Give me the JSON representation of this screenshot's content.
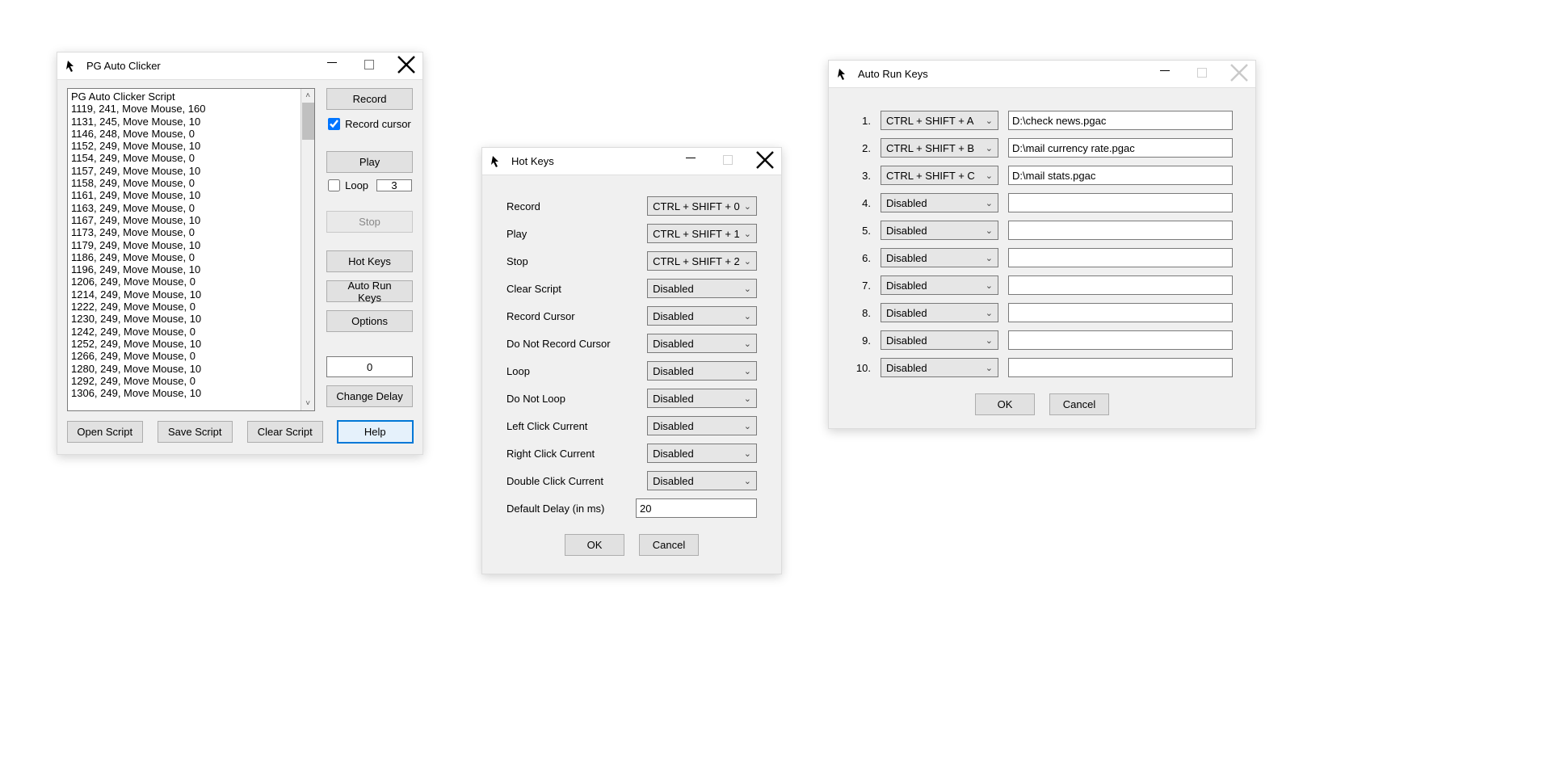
{
  "main": {
    "title": "PG Auto Clicker",
    "script_lines": [
      "PG Auto Clicker Script",
      "1119, 241, Move Mouse, 160",
      "1131, 245, Move Mouse, 10",
      "1146, 248, Move Mouse, 0",
      "1152, 249, Move Mouse, 10",
      "1154, 249, Move Mouse, 0",
      "1157, 249, Move Mouse, 10",
      "1158, 249, Move Mouse, 0",
      "1161, 249, Move Mouse, 10",
      "1163, 249, Move Mouse, 0",
      "1167, 249, Move Mouse, 10",
      "1173, 249, Move Mouse, 0",
      "1179, 249, Move Mouse, 10",
      "1186, 249, Move Mouse, 0",
      "1196, 249, Move Mouse, 10",
      "1206, 249, Move Mouse, 0",
      "1214, 249, Move Mouse, 10",
      "1222, 249, Move Mouse, 0",
      "1230, 249, Move Mouse, 10",
      "1242, 249, Move Mouse, 0",
      "1252, 249, Move Mouse, 10",
      "1266, 249, Move Mouse, 0",
      "1280, 249, Move Mouse, 10",
      "1292, 249, Move Mouse, 0",
      "1306, 249, Move Mouse, 10"
    ],
    "buttons": {
      "record": "Record",
      "play": "Play",
      "stop": "Stop",
      "hotkeys": "Hot Keys",
      "autorunkeys": "Auto Run Keys",
      "options": "Options",
      "change_delay": "Change Delay",
      "open_script": "Open Script",
      "save_script": "Save Script",
      "clear_script": "Clear Script",
      "help": "Help"
    },
    "record_cursor_label": "Record cursor",
    "record_cursor_checked": true,
    "loop_label": "Loop",
    "loop_checked": false,
    "loop_value": "3",
    "delay_value": "0"
  },
  "hotkeys": {
    "title": "Hot Keys",
    "rows": [
      {
        "label": "Record",
        "value": "CTRL + SHIFT + 0"
      },
      {
        "label": "Play",
        "value": "CTRL + SHIFT + 1"
      },
      {
        "label": "Stop",
        "value": "CTRL + SHIFT + 2"
      },
      {
        "label": "Clear Script",
        "value": "Disabled"
      },
      {
        "label": "Record Cursor",
        "value": "Disabled"
      },
      {
        "label": "Do Not Record Cursor",
        "value": "Disabled"
      },
      {
        "label": "Loop",
        "value": "Disabled"
      },
      {
        "label": "Do Not Loop",
        "value": "Disabled"
      },
      {
        "label": "Left Click Current",
        "value": "Disabled"
      },
      {
        "label": "Right Click Current",
        "value": "Disabled"
      },
      {
        "label": "Double Click Current",
        "value": "Disabled"
      }
    ],
    "delay_label": "Default Delay (in ms)",
    "delay_value": "20",
    "ok": "OK",
    "cancel": "Cancel"
  },
  "autorun": {
    "title": "Auto Run Keys",
    "rows": [
      {
        "n": "1.",
        "key": "CTRL + SHIFT + A",
        "path": "D:\\check news.pgac"
      },
      {
        "n": "2.",
        "key": "CTRL + SHIFT + B",
        "path": "D:\\mail currency rate.pgac"
      },
      {
        "n": "3.",
        "key": "CTRL + SHIFT + C",
        "path": "D:\\mail stats.pgac"
      },
      {
        "n": "4.",
        "key": "Disabled",
        "path": ""
      },
      {
        "n": "5.",
        "key": "Disabled",
        "path": ""
      },
      {
        "n": "6.",
        "key": "Disabled",
        "path": ""
      },
      {
        "n": "7.",
        "key": "Disabled",
        "path": ""
      },
      {
        "n": "8.",
        "key": "Disabled",
        "path": ""
      },
      {
        "n": "9.",
        "key": "Disabled",
        "path": ""
      },
      {
        "n": "10.",
        "key": "Disabled",
        "path": ""
      }
    ],
    "ok": "OK",
    "cancel": "Cancel"
  }
}
